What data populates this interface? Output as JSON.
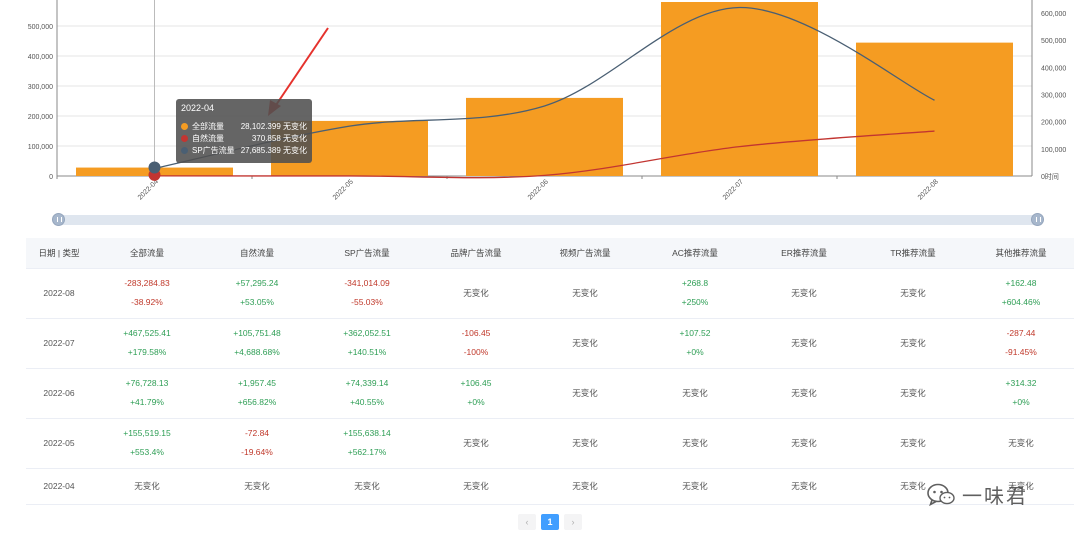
{
  "chart_data": {
    "type": "bar",
    "categories": [
      "2022-04",
      "2022-05",
      "2022-06",
      "2022-07",
      "2022-08"
    ],
    "series": [
      {
        "name": "全部流量",
        "kind": "bar",
        "axis": "left",
        "values": [
          28102.399,
          183621.54,
          260349.67,
          727875.08,
          444590.25
        ]
      },
      {
        "name": "自然流量",
        "kind": "line",
        "axis": "right",
        "values": [
          370.858,
          298.02,
          2255.47,
          108007,
          165302
        ]
      },
      {
        "name": "SP广告流量",
        "kind": "line",
        "axis": "right",
        "values": [
          27685.389,
          183323.53,
          257663,
          619715,
          278701
        ]
      }
    ],
    "left_axis": {
      "ticks": [
        "0",
        "100,000",
        "200,000",
        "300,000",
        "400,000",
        "500,000"
      ],
      "ylim": [
        0,
        580000
      ]
    },
    "right_axis": {
      "ticks": [
        "0时间",
        "100,000",
        "200,000",
        "300,000",
        "400,000",
        "500,000",
        "600,000"
      ],
      "ylim": [
        0,
        640000
      ]
    },
    "colors": {
      "bar": "#f59c22",
      "natural": "#c23531",
      "sp": "#4a5f73"
    }
  },
  "tooltip": {
    "title": "2022-04",
    "rows": [
      {
        "name": "全部流量",
        "value": "28,102.399 无变化",
        "color": "#f59c22"
      },
      {
        "name": "自然流量",
        "value": "370.858 无变化",
        "color": "#c23531"
      },
      {
        "name": "SP广告流量",
        "value": "27,685.389 无变化",
        "color": "#4a5f73"
      }
    ]
  },
  "table": {
    "headers": [
      "日期 | 类型",
      "全部流量",
      "自然流量",
      "SP广告流量",
      "品牌广告流量",
      "视频广告流量",
      "AC推荐流量",
      "ER推荐流量",
      "TR推荐流量",
      "其他推荐流量"
    ],
    "rows": [
      {
        "date": "2022-08",
        "cells": [
          {
            "a": "-283,284.83",
            "b": "-38.92%",
            "t": "neg"
          },
          {
            "a": "+57,295.24",
            "b": "+53.05%",
            "t": "pos"
          },
          {
            "a": "-341,014.09",
            "b": "-55.03%",
            "t": "neg"
          },
          {
            "a": "无变化",
            "t": "none"
          },
          {
            "a": "无变化",
            "t": "none"
          },
          {
            "a": "+268.8",
            "b": "+250%",
            "t": "pos"
          },
          {
            "a": "无变化",
            "t": "none"
          },
          {
            "a": "无变化",
            "t": "none"
          },
          {
            "a": "+162.48",
            "b": "+604.46%",
            "t": "pos"
          }
        ]
      },
      {
        "date": "2022-07",
        "cells": [
          {
            "a": "+467,525.41",
            "b": "+179.58%",
            "t": "pos"
          },
          {
            "a": "+105,751.48",
            "b": "+4,688.68%",
            "t": "pos"
          },
          {
            "a": "+362,052.51",
            "b": "+140.51%",
            "t": "pos"
          },
          {
            "a": "-106.45",
            "b": "-100%",
            "t": "neg"
          },
          {
            "a": "无变化",
            "t": "none"
          },
          {
            "a": "+107.52",
            "b": "+0%",
            "t": "pos"
          },
          {
            "a": "无变化",
            "t": "none"
          },
          {
            "a": "无变化",
            "t": "none"
          },
          {
            "a": "-287.44",
            "b": "-91.45%",
            "t": "neg"
          }
        ]
      },
      {
        "date": "2022-06",
        "cells": [
          {
            "a": "+76,728.13",
            "b": "+41.79%",
            "t": "pos"
          },
          {
            "a": "+1,957.45",
            "b": "+656.82%",
            "t": "pos"
          },
          {
            "a": "+74,339.14",
            "b": "+40.55%",
            "t": "pos"
          },
          {
            "a": "+106.45",
            "b": "+0%",
            "t": "pos"
          },
          {
            "a": "无变化",
            "t": "none"
          },
          {
            "a": "无变化",
            "t": "none"
          },
          {
            "a": "无变化",
            "t": "none"
          },
          {
            "a": "无变化",
            "t": "none"
          },
          {
            "a": "+314.32",
            "b": "+0%",
            "t": "pos"
          }
        ]
      },
      {
        "date": "2022-05",
        "cells": [
          {
            "a": "+155,519.15",
            "b": "+553.4%",
            "t": "pos"
          },
          {
            "a": "-72.84",
            "b": "-19.64%",
            "t": "neg"
          },
          {
            "a": "+155,638.14",
            "b": "+562.17%",
            "t": "pos"
          },
          {
            "a": "无变化",
            "t": "none"
          },
          {
            "a": "无变化",
            "t": "none"
          },
          {
            "a": "无变化",
            "t": "none"
          },
          {
            "a": "无变化",
            "t": "none"
          },
          {
            "a": "无变化",
            "t": "none"
          },
          {
            "a": "无变化",
            "t": "none"
          }
        ]
      },
      {
        "date": "2022-04",
        "cells": [
          {
            "a": "无变化",
            "t": "none"
          },
          {
            "a": "无变化",
            "t": "none"
          },
          {
            "a": "无变化",
            "t": "none"
          },
          {
            "a": "无变化",
            "t": "none"
          },
          {
            "a": "无变化",
            "t": "none"
          },
          {
            "a": "无变化",
            "t": "none"
          },
          {
            "a": "无变化",
            "t": "none"
          },
          {
            "a": "无变化",
            "t": "none"
          },
          {
            "a": "无变化",
            "t": "none"
          }
        ]
      }
    ]
  },
  "pagination": {
    "prev": "‹",
    "current": "1",
    "next": "›"
  },
  "watermark": {
    "text": "一味君",
    "icon": "wechat-icon"
  }
}
